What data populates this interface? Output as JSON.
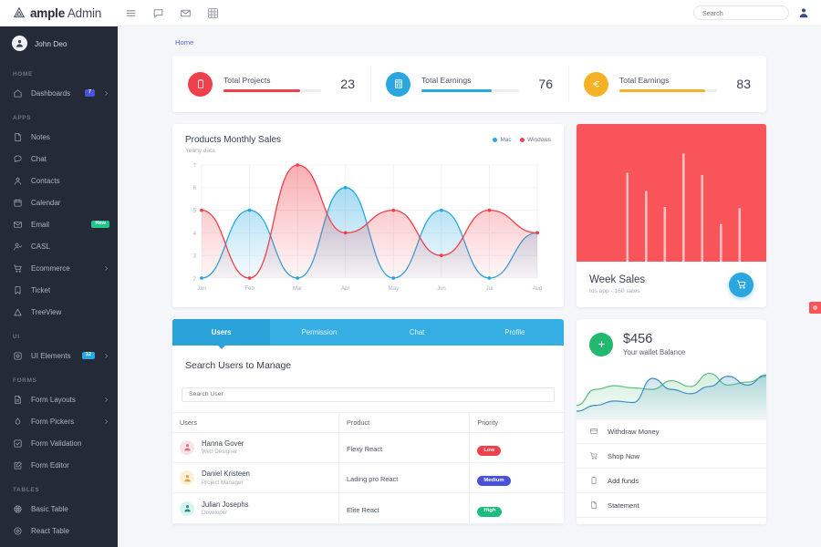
{
  "brand": {
    "bold": "ample",
    "light": "Admin",
    "logo_icon": "triangle-logo-icon"
  },
  "topbar": {
    "icons": [
      "hamburger-icon",
      "comment-icon",
      "envelope-icon",
      "grid-icon"
    ],
    "search_placeholder": "Search",
    "search_value": "",
    "avatar_icon": "user-avatar-icon"
  },
  "sidebar": {
    "profile": {
      "name": "John Deo",
      "avatar_icon": "user-circle-icon"
    },
    "sections": [
      {
        "label": "HOME",
        "items": [
          {
            "label": "Dashboards",
            "icon": "home-icon",
            "badge": "7",
            "badge_color": "#4a52d8",
            "chevron": true
          }
        ]
      },
      {
        "label": "APPS",
        "items": [
          {
            "label": "Notes",
            "icon": "note-icon",
            "badge": "",
            "chevron": false
          },
          {
            "label": "Chat",
            "icon": "chat-icon",
            "badge": "",
            "chevron": false
          },
          {
            "label": "Contacts",
            "icon": "contact-icon",
            "badge": "",
            "chevron": false
          },
          {
            "label": "Calendar",
            "icon": "calendar-icon",
            "badge": "",
            "chevron": false
          },
          {
            "label": "Email",
            "icon": "mail-icon",
            "badge": "New",
            "badge_color": "#22c58b",
            "chevron": false
          },
          {
            "label": "CASL",
            "icon": "user-check-icon",
            "badge": "",
            "chevron": false
          },
          {
            "label": "Ecommerce",
            "icon": "cart-icon",
            "badge": "",
            "chevron": true
          },
          {
            "label": "Ticket",
            "icon": "bookmark-icon",
            "badge": "",
            "chevron": false
          },
          {
            "label": "TreeView",
            "icon": "triangle-icon",
            "badge": "",
            "chevron": false
          }
        ]
      },
      {
        "label": "UI",
        "items": [
          {
            "label": "UI Elements",
            "icon": "settings-icon",
            "badge": "12",
            "badge_color": "#2aa7e0",
            "chevron": true
          }
        ]
      },
      {
        "label": "FORMS",
        "items": [
          {
            "label": "Form Layouts",
            "icon": "file-icon",
            "badge": "",
            "chevron": true
          },
          {
            "label": "Form Pickers",
            "icon": "droplet-icon",
            "badge": "",
            "chevron": true
          },
          {
            "label": "Form Validation",
            "icon": "check-square-icon",
            "badge": "",
            "chevron": false
          },
          {
            "label": "Form Editor",
            "icon": "edit-square-icon",
            "badge": "",
            "chevron": false
          }
        ]
      },
      {
        "label": "TABLES",
        "items": [
          {
            "label": "Basic Table",
            "icon": "table-icon",
            "badge": "",
            "chevron": false
          },
          {
            "label": "React Table",
            "icon": "react-icon",
            "badge": "",
            "chevron": false
          }
        ]
      }
    ]
  },
  "main": {
    "breadcrumb": "Home",
    "stats": [
      {
        "title": "Total Projects",
        "value": "23",
        "color": "#f0404b",
        "progress": 78,
        "icon": "clipboard-icon"
      },
      {
        "title": "Total Earnings",
        "value": "76",
        "color": "#2aa7e0",
        "progress": 72,
        "icon": "calculator-icon"
      },
      {
        "title": "Total Earnings",
        "value": "83",
        "color": "#f5b225",
        "progress": 88,
        "icon": "euro-icon"
      }
    ],
    "week_sales": {
      "title": "Week Sales",
      "subtitle": "Ios app - 160 sales",
      "bg_color": "#f8545a",
      "cart_icon": "cart-icon"
    },
    "users_panel": {
      "tabs": [
        {
          "label": "Users",
          "active": true
        },
        {
          "label": "Permission",
          "active": false
        },
        {
          "label": "Chat",
          "active": false
        },
        {
          "label": "Profile",
          "active": false
        }
      ],
      "heading": "Search Users to Manage",
      "search_placeholder": "Search User",
      "search_value": "",
      "columns": [
        "Users",
        "Product",
        "Priority"
      ],
      "rows": [
        {
          "name": "Hanna Gover",
          "role": "Web Designer",
          "product": "Flexy React",
          "priority": "Low",
          "priority_class": "p-low",
          "avatar_bg": "#fbe3e7",
          "avatar_color": "#e0707f"
        },
        {
          "name": "Daniel Kristeen",
          "role": "Project Manager",
          "product": "Lading pro React",
          "priority": "Medium",
          "priority_class": "p-med",
          "avatar_bg": "#fdf0d7",
          "avatar_color": "#d9a441"
        },
        {
          "name": "Julian Josephs",
          "role": "Developer",
          "product": "Elite React",
          "priority": "High",
          "priority_class": "p-high",
          "avatar_bg": "#d6f5ee",
          "avatar_color": "#2f8f7d"
        }
      ]
    },
    "wallet": {
      "amount": "$456",
      "subtitle": "Your wallet Balance",
      "icon": "plus-icon",
      "icon_color": "#22b96f",
      "menu": [
        {
          "label": "Withdraw Money",
          "icon": "wallet-icon"
        },
        {
          "label": "Shop Now",
          "icon": "cart-icon"
        },
        {
          "label": "Add funds",
          "icon": "clipboard-icon"
        },
        {
          "label": "Statement",
          "icon": "document-icon"
        }
      ]
    },
    "edge_button": {
      "name": "theme-settings-button",
      "color": "#f8545a"
    }
  },
  "chart_data": [
    {
      "type": "area",
      "title": "Products Monthly Sales",
      "subtitle": "Yearly data",
      "xlabel": "",
      "ylabel": "",
      "categories": [
        "Jan",
        "Feb",
        "Mar",
        "Apr",
        "May",
        "Jun",
        "Jul",
        "Aug"
      ],
      "ylim": [
        2,
        7
      ],
      "yticks": [
        2,
        3,
        4,
        5,
        6,
        7
      ],
      "grid": true,
      "legend_position": "top-right",
      "series": [
        {
          "name": "Mac",
          "color": "#2aa7e0",
          "values": [
            2,
            5,
            2,
            6,
            2,
            5,
            2,
            4
          ]
        },
        {
          "name": "Windows",
          "color": "#f0404b",
          "values": [
            5,
            2,
            7,
            4,
            5,
            3,
            5,
            4
          ]
        }
      ]
    },
    {
      "type": "bar",
      "title": "Week Sales",
      "categories": [
        "1",
        "2",
        "3",
        "4",
        "5",
        "6",
        "7",
        "8"
      ],
      "values": [
        0,
        78,
        62,
        48,
        95,
        76,
        33,
        47
      ],
      "ylim": [
        0,
        100
      ],
      "grid": false
    },
    {
      "type": "area",
      "title": "Wallet Balance",
      "x": [
        0,
        1,
        2,
        3,
        4,
        5,
        6,
        7,
        8,
        9,
        10
      ],
      "grid": false,
      "series": [
        {
          "name": "series-green",
          "color": "#5cbf7f",
          "values": [
            18,
            40,
            45,
            42,
            40,
            52,
            44,
            62,
            46,
            50,
            58
          ]
        },
        {
          "name": "series-blue",
          "color": "#3d8fc4",
          "values": [
            10,
            18,
            24,
            22,
            55,
            40,
            34,
            44,
            58,
            46,
            60
          ]
        }
      ]
    }
  ]
}
